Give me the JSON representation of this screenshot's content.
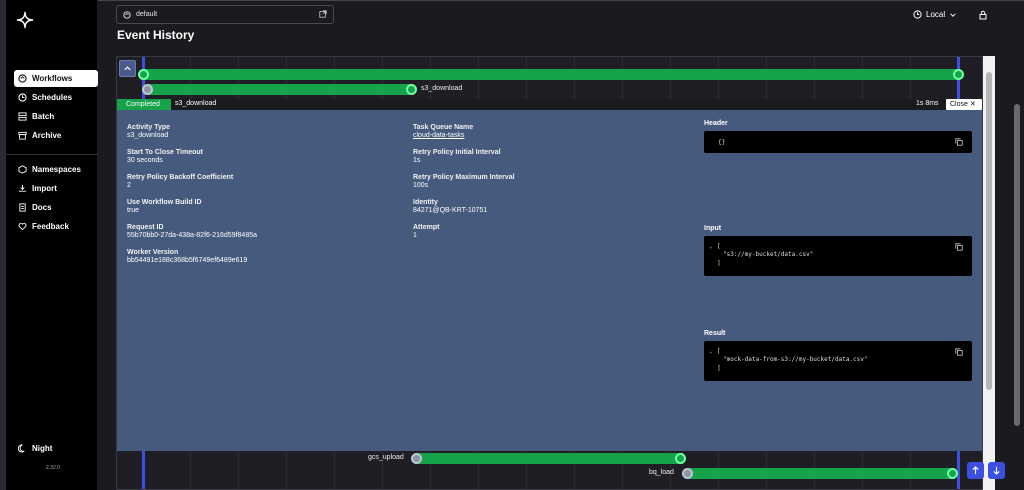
{
  "sidebar": {
    "items": [
      {
        "label": "Workflows",
        "icon": "workflows-icon",
        "active": true
      },
      {
        "label": "Schedules",
        "icon": "clock-icon"
      },
      {
        "label": "Batch",
        "icon": "batch-icon"
      },
      {
        "label": "Archive",
        "icon": "archive-icon"
      }
    ],
    "items2": [
      {
        "label": "Namespaces",
        "icon": "cube-icon"
      },
      {
        "label": "Import",
        "icon": "import-icon"
      },
      {
        "label": "Docs",
        "icon": "docs-icon"
      },
      {
        "label": "Feedback",
        "icon": "heart-icon"
      }
    ],
    "theme_label": "Night",
    "version": "2.32.0"
  },
  "topbar": {
    "namespace": "default",
    "timezone": "Local"
  },
  "page": {
    "title": "Event History"
  },
  "timeline": {
    "rows": [
      {
        "label": "s3_download"
      },
      {
        "label": "gcs_upload"
      },
      {
        "label": "bq_load"
      }
    ]
  },
  "detail": {
    "status": "Completed",
    "activity": "s3_download",
    "duration": "1s 8ms",
    "close_label": "Close",
    "fields_left": [
      {
        "key": "Activity Type",
        "value": "s3_download"
      },
      {
        "key": "Start To Close Timeout",
        "value": "30 seconds"
      },
      {
        "key": "Retry Policy Backoff Coefficient",
        "value": "2"
      },
      {
        "key": "Use Workflow Build ID",
        "value": "true"
      },
      {
        "key": "Request ID",
        "value": "55b70bb0-27da-438a-82f6-216d59f8485a"
      },
      {
        "key": "Worker Version",
        "value": "bb54491e188c368b5f6749ef6489e619"
      }
    ],
    "fields_mid": [
      {
        "key": "Task Queue Name",
        "value": "cloud-data-tasks"
      },
      {
        "key": "Retry Policy Initial Interval",
        "value": "1s"
      },
      {
        "key": "Retry Policy Maximum Interval",
        "value": "100s"
      },
      {
        "key": "Identity",
        "value": "84271@QB-KRT-10751"
      },
      {
        "key": "Attempt",
        "value": "1"
      }
    ],
    "header": {
      "label": "Header",
      "code": "{}"
    },
    "input": {
      "label": "Input",
      "lines": [
        "[",
        "\"s3://my-bucket/data.csv\"",
        "]"
      ]
    },
    "result": {
      "label": "Result",
      "lines": [
        "[",
        "\"mock-data-from-s3://my-bucket/data.csv\"",
        "]"
      ]
    }
  },
  "colors": {
    "accent": "#3b4fe0",
    "completed": "#16a34a",
    "detail_bg": "#455a7c"
  }
}
